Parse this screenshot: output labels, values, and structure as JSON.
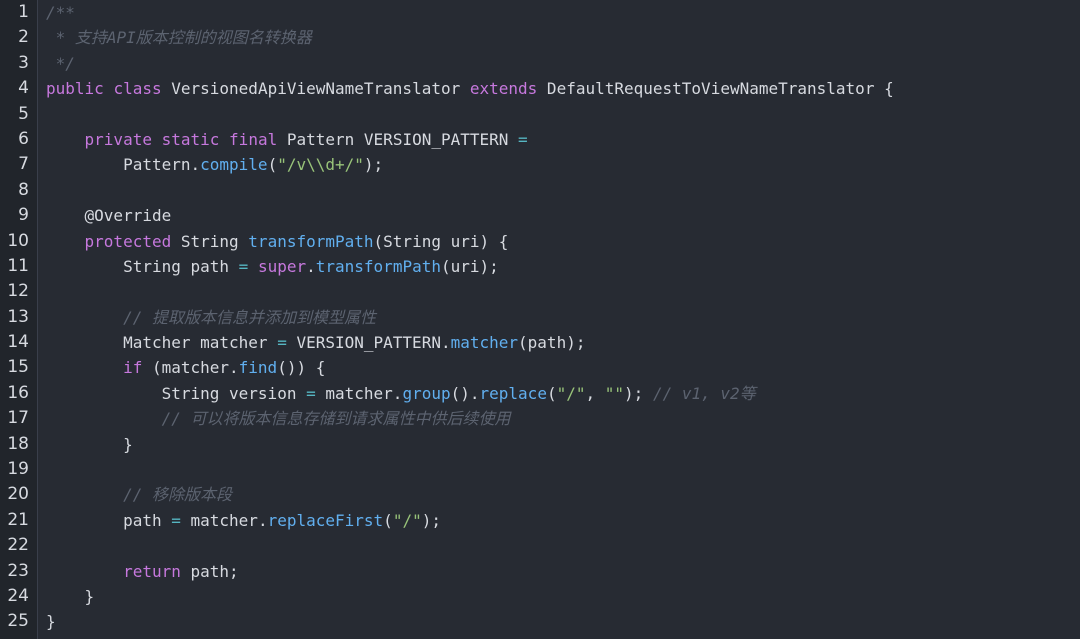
{
  "lines": [
    [
      {
        "t": "/**",
        "c": "cm"
      }
    ],
    [
      {
        "t": " * 支持API版本控制的视图名转换器",
        "c": "cm"
      }
    ],
    [
      {
        "t": " */",
        "c": "cm"
      }
    ],
    [
      {
        "t": "public",
        "c": "kw"
      },
      {
        "t": " ",
        "c": "pl"
      },
      {
        "t": "class",
        "c": "kw"
      },
      {
        "t": " VersionedApiViewNameTranslator ",
        "c": "pl"
      },
      {
        "t": "extends",
        "c": "kw"
      },
      {
        "t": " DefaultRequestToViewNameTranslator {",
        "c": "pl"
      }
    ],
    [],
    [
      {
        "t": "    ",
        "c": "pl"
      },
      {
        "t": "private",
        "c": "kw"
      },
      {
        "t": " ",
        "c": "pl"
      },
      {
        "t": "static",
        "c": "kw"
      },
      {
        "t": " ",
        "c": "pl"
      },
      {
        "t": "final",
        "c": "kw"
      },
      {
        "t": " Pattern VERSION_PATTERN ",
        "c": "pl"
      },
      {
        "t": "=",
        "c": "op"
      }
    ],
    [
      {
        "t": "        Pattern.",
        "c": "pl"
      },
      {
        "t": "compile",
        "c": "fn"
      },
      {
        "t": "(",
        "c": "pl"
      },
      {
        "t": "\"/v\\\\d+/\"",
        "c": "str"
      },
      {
        "t": ");",
        "c": "pl"
      }
    ],
    [],
    [
      {
        "t": "    @Override",
        "c": "an"
      }
    ],
    [
      {
        "t": "    ",
        "c": "pl"
      },
      {
        "t": "protected",
        "c": "kw"
      },
      {
        "t": " String ",
        "c": "pl"
      },
      {
        "t": "transformPath",
        "c": "fn"
      },
      {
        "t": "(String uri) {",
        "c": "pl"
      }
    ],
    [
      {
        "t": "        String path ",
        "c": "pl"
      },
      {
        "t": "=",
        "c": "op"
      },
      {
        "t": " ",
        "c": "pl"
      },
      {
        "t": "super",
        "c": "kw"
      },
      {
        "t": ".",
        "c": "pl"
      },
      {
        "t": "transformPath",
        "c": "fn"
      },
      {
        "t": "(uri);",
        "c": "pl"
      }
    ],
    [],
    [
      {
        "t": "        ",
        "c": "pl"
      },
      {
        "t": "// 提取版本信息并添加到模型属性",
        "c": "cm"
      }
    ],
    [
      {
        "t": "        Matcher matcher ",
        "c": "pl"
      },
      {
        "t": "=",
        "c": "op"
      },
      {
        "t": " VERSION_PATTERN.",
        "c": "pl"
      },
      {
        "t": "matcher",
        "c": "fn"
      },
      {
        "t": "(path);",
        "c": "pl"
      }
    ],
    [
      {
        "t": "        ",
        "c": "pl"
      },
      {
        "t": "if",
        "c": "kw"
      },
      {
        "t": " (matcher.",
        "c": "pl"
      },
      {
        "t": "find",
        "c": "fn"
      },
      {
        "t": "()) {",
        "c": "pl"
      }
    ],
    [
      {
        "t": "            String version ",
        "c": "pl"
      },
      {
        "t": "=",
        "c": "op"
      },
      {
        "t": " matcher.",
        "c": "pl"
      },
      {
        "t": "group",
        "c": "fn"
      },
      {
        "t": "().",
        "c": "pl"
      },
      {
        "t": "replace",
        "c": "fn"
      },
      {
        "t": "(",
        "c": "pl"
      },
      {
        "t": "\"/\"",
        "c": "str"
      },
      {
        "t": ", ",
        "c": "pl"
      },
      {
        "t": "\"\"",
        "c": "str"
      },
      {
        "t": "); ",
        "c": "pl"
      },
      {
        "t": "// v1, v2等",
        "c": "cm"
      }
    ],
    [
      {
        "t": "            ",
        "c": "pl"
      },
      {
        "t": "// 可以将版本信息存储到请求属性中供后续使用",
        "c": "cm"
      }
    ],
    [
      {
        "t": "        }",
        "c": "pl"
      }
    ],
    [],
    [
      {
        "t": "        ",
        "c": "pl"
      },
      {
        "t": "// 移除版本段",
        "c": "cm"
      }
    ],
    [
      {
        "t": "        path ",
        "c": "pl"
      },
      {
        "t": "=",
        "c": "op"
      },
      {
        "t": " matcher.",
        "c": "pl"
      },
      {
        "t": "replaceFirst",
        "c": "fn"
      },
      {
        "t": "(",
        "c": "pl"
      },
      {
        "t": "\"/\"",
        "c": "str"
      },
      {
        "t": ");",
        "c": "pl"
      }
    ],
    [],
    [
      {
        "t": "        ",
        "c": "pl"
      },
      {
        "t": "return",
        "c": "kw"
      },
      {
        "t": " path;",
        "c": "pl"
      }
    ],
    [
      {
        "t": "    }",
        "c": "pl"
      }
    ],
    [
      {
        "t": "}",
        "c": "pl"
      }
    ]
  ]
}
